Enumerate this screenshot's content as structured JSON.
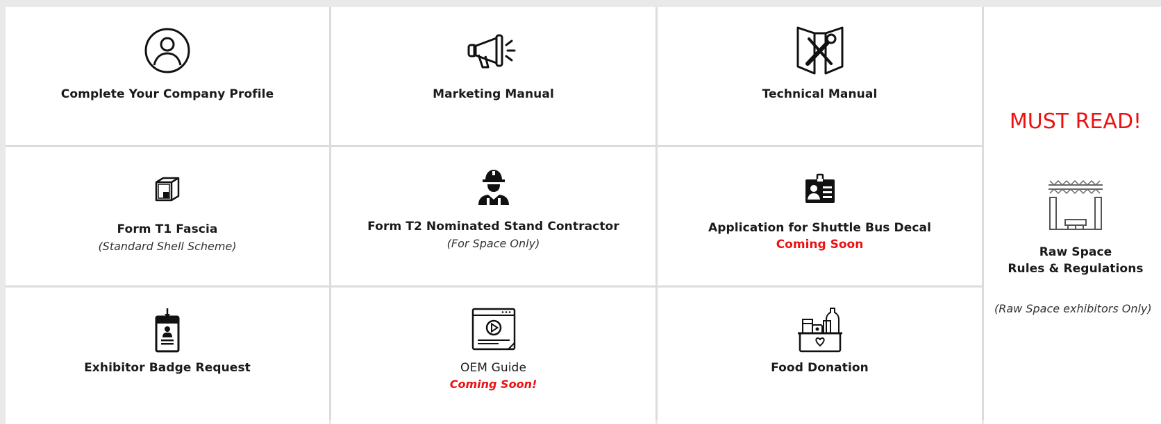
{
  "tiles": {
    "company_profile": {
      "title": "Complete Your Company Profile",
      "icon": "user-profile-icon"
    },
    "marketing_manual": {
      "title": "Marketing Manual",
      "icon": "megaphone-icon"
    },
    "technical_manual": {
      "title": "Technical Manual",
      "icon": "tools-manual-icon"
    },
    "form_t1": {
      "title": "Form T1 Fascia",
      "subtitle": "(Standard Shell Scheme)",
      "icon": "booth-icon"
    },
    "form_t2": {
      "title": "Form T2 Nominated Stand Contractor",
      "subtitle": "(For Space Only)",
      "icon": "contractor-icon"
    },
    "shuttle_bus": {
      "title": "Application for Shuttle Bus Decal",
      "status": "Coming Soon",
      "icon": "id-card-icon"
    },
    "badge_request": {
      "title": "Exhibitor Badge Request",
      "icon": "badge-icon"
    },
    "oem_guide": {
      "title": "OEM Guide",
      "status": "Coming Soon!",
      "icon": "video-guide-icon"
    },
    "food_donation": {
      "title": "Food Donation",
      "icon": "food-box-icon"
    },
    "raw_space": {
      "heading": "MUST READ!",
      "title_line1": "Raw Space",
      "title_line2": "Rules & Regulations",
      "note": "(Raw Space exhibitors Only)",
      "icon": "raw-space-stage-icon"
    }
  },
  "colors": {
    "accent_red": "#ee1111",
    "text": "#1a1a1a",
    "background": "#e9e9e9",
    "tile": "#ffffff"
  }
}
